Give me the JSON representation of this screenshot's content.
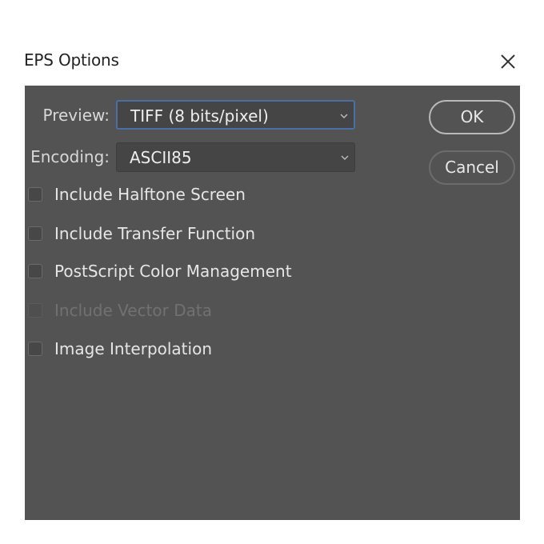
{
  "dialog": {
    "title": "EPS Options",
    "close_icon": "close-icon"
  },
  "fields": {
    "preview": {
      "label": "Preview:",
      "value": "TIFF  (8 bits/pixel)"
    },
    "encoding": {
      "label": "Encoding:",
      "value": "ASCII85"
    }
  },
  "options": [
    {
      "label": "Include Halftone Screen",
      "checked": false,
      "enabled": true
    },
    {
      "label": "Include Transfer Function",
      "checked": false,
      "enabled": true
    },
    {
      "label": "PostScript Color Management",
      "checked": false,
      "enabled": true
    },
    {
      "label": "Include Vector Data",
      "checked": false,
      "enabled": false
    },
    {
      "label": "Image Interpolation",
      "checked": false,
      "enabled": true
    }
  ],
  "buttons": {
    "ok": "OK",
    "cancel": "Cancel"
  },
  "colors": {
    "panel_background": "#535353",
    "focus_border": "#4a6fa5"
  }
}
